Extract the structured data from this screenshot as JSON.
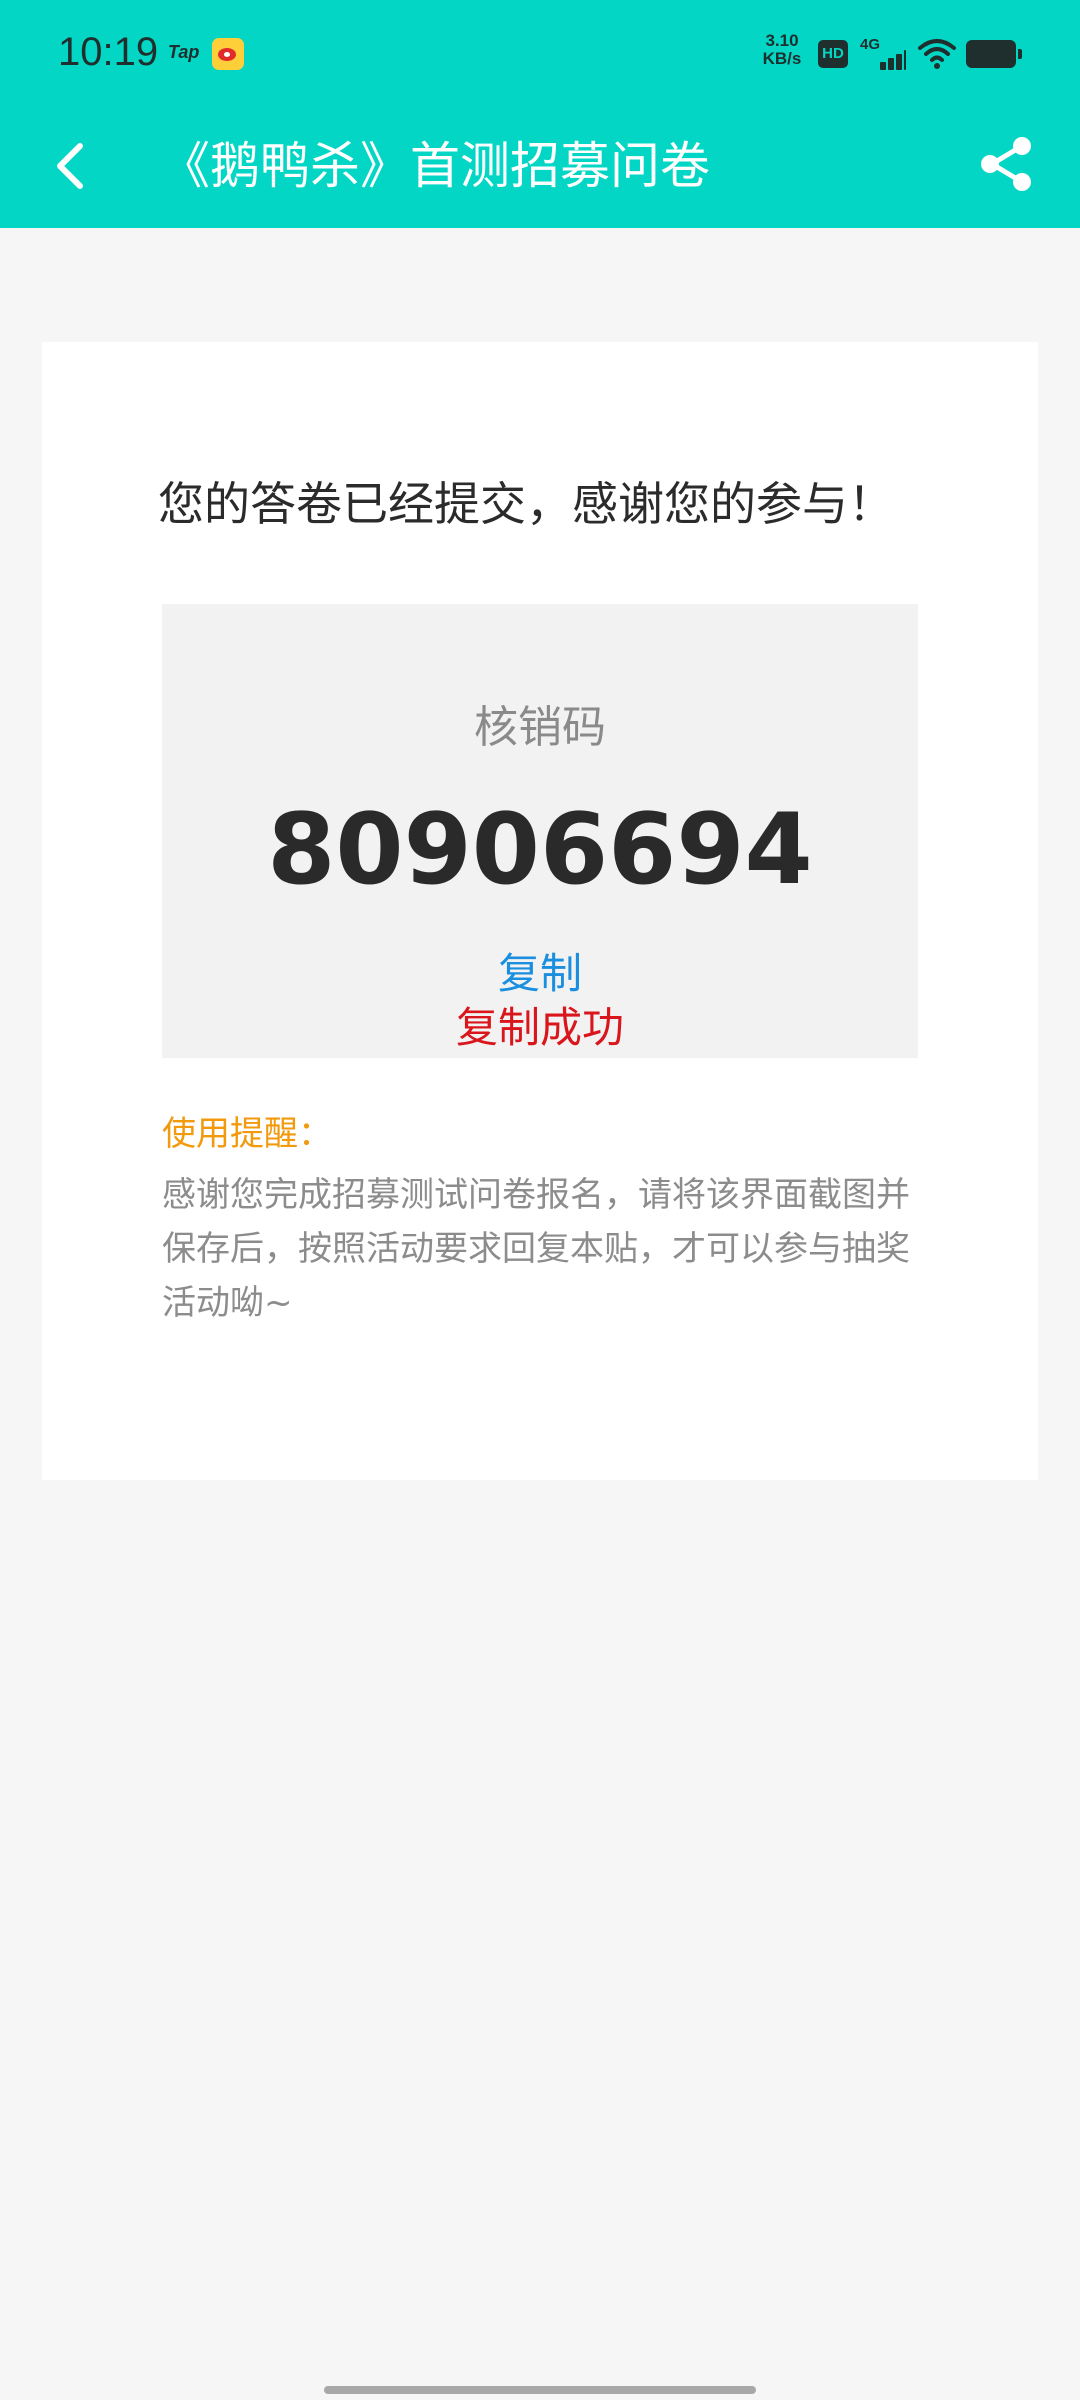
{
  "status_bar": {
    "time": "10:19",
    "tap_label": "Tap",
    "net_speed_value": "3.10",
    "net_speed_unit": "KB/s",
    "hd_label": "HD",
    "network_label": "4G",
    "icons": [
      "tap-icon",
      "weibo-icon",
      "hd-icon",
      "signal-icon",
      "wifi-icon",
      "battery-icon"
    ]
  },
  "header": {
    "title": "《鹅鸭杀》首测招募问卷",
    "back_icon": "chevron-left-icon",
    "share_icon": "share-icon",
    "background_color": "#03d6c4"
  },
  "result": {
    "message": "您的答卷已经提交，感谢您的参与！",
    "code_label": "核销码",
    "code_value": "80906694",
    "copy_label": "复制",
    "copy_success_label": "复制成功"
  },
  "reminder": {
    "title": "使用提醒：",
    "text": "感谢您完成招募测试问卷报名，请将该界面截图并保存后，按照活动要求回复本贴，才可以参与抽奖活动呦~"
  },
  "colors": {
    "accent": "#03d6c4",
    "link": "#1a8fe0",
    "success": "#d9161c",
    "reminder_title": "#f29a0c"
  }
}
